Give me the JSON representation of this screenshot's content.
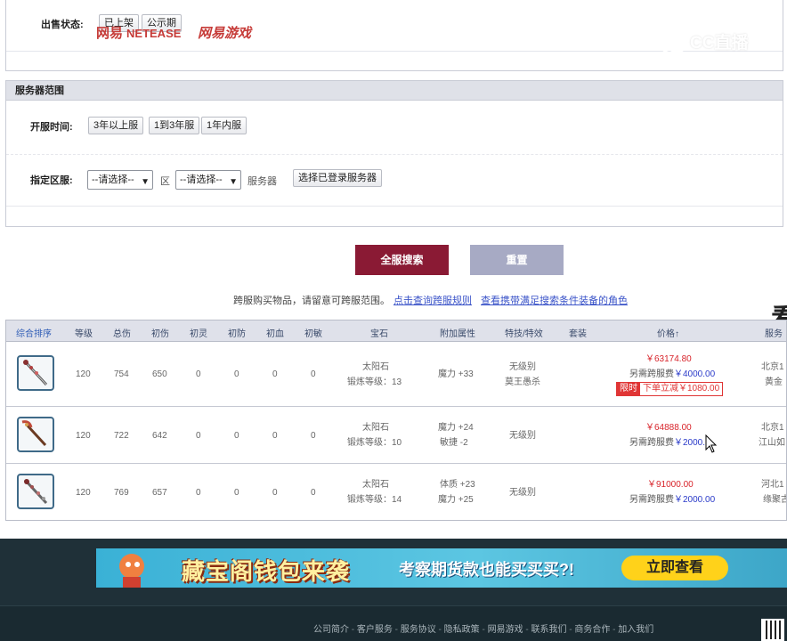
{
  "watermark": "CC直播",
  "sale_status": {
    "label": "出售状态:",
    "options": [
      "已上架",
      "公示期"
    ]
  },
  "server_range": {
    "title": "服务器范围",
    "open_time_label": "开服时间:",
    "open_time_options": [
      "3年以上服",
      "1到3年服",
      "1年内服"
    ],
    "zone_label": "指定区服:",
    "select1": "--请选择--",
    "zone_word": "区",
    "select2": "--请选择--",
    "server_word": "服务器",
    "choose_logged_btn": "选择已登录服务器"
  },
  "actions": {
    "search_label": "全服搜索",
    "reset_label": "重置"
  },
  "tip": {
    "text": "跨服购买物品，请留意可跨服范围。",
    "link1": "点击查询跨服规则",
    "link2": "查看携带满足搜索条件装备的角色"
  },
  "side_char": "看",
  "table": {
    "headers": [
      "综合排序",
      "等级",
      "总伤",
      "初伤",
      "初灵",
      "初防",
      "初血",
      "初敏",
      "宝石",
      "附加属性",
      "特技/特效",
      "套装",
      "价格↑",
      "服务"
    ],
    "rows": [
      {
        "level": "120",
        "total": "754",
        "init_dmg": "650",
        "ling": "0",
        "fang": "0",
        "xue": "0",
        "min": "0",
        "gem": "太阳石",
        "gem_level": "锻炼等级：13",
        "attrs": [
          "魔力 +33"
        ],
        "skills": [
          "无级别",
          "莫王愚杀"
        ],
        "set": "",
        "price": "￥63174.80",
        "fee_prefix": "另需跨服费",
        "fee": "￥4000.00",
        "promo_tag": "限时",
        "promo_text": "下单立减￥1080.00",
        "server": [
          "北京1",
          "黄金"
        ]
      },
      {
        "level": "120",
        "total": "722",
        "init_dmg": "642",
        "ling": "0",
        "fang": "0",
        "xue": "0",
        "min": "0",
        "gem": "太阳石",
        "gem_level": "锻炼等级：10",
        "attrs": [
          "魔力 +24",
          "敏捷 -2"
        ],
        "skills": [
          "无级别"
        ],
        "set": "",
        "price": "￥64888.00",
        "fee_prefix": "另需跨服费",
        "fee": "￥2000.",
        "server": [
          "北京1",
          "江山如"
        ]
      },
      {
        "level": "120",
        "total": "769",
        "init_dmg": "657",
        "ling": "0",
        "fang": "0",
        "xue": "0",
        "min": "0",
        "gem": "太阳石",
        "gem_level": "锻炼等级：14",
        "attrs": [
          "体质 +23",
          "魔力 +25"
        ],
        "skills": [
          "无级别"
        ],
        "set": "",
        "price": "￥91000.00",
        "fee_prefix": "另需跨服费",
        "fee": "￥2000.00",
        "server": [
          "河北1",
          "缘聚古"
        ]
      }
    ]
  },
  "banner": {
    "title": "藏宝阁钱包来袭",
    "subtitle": "考察期货款也能买买买?!",
    "button": "立即查看"
  },
  "footer": {
    "logo1": "网易",
    "logo1_en": "NETEASE",
    "logo2": "网易游戏",
    "links": [
      "公司简介",
      "客户服务",
      "服务协议",
      "隐私政策",
      "网易游戏",
      "联系我们",
      "商务合作",
      "加入我们"
    ]
  }
}
